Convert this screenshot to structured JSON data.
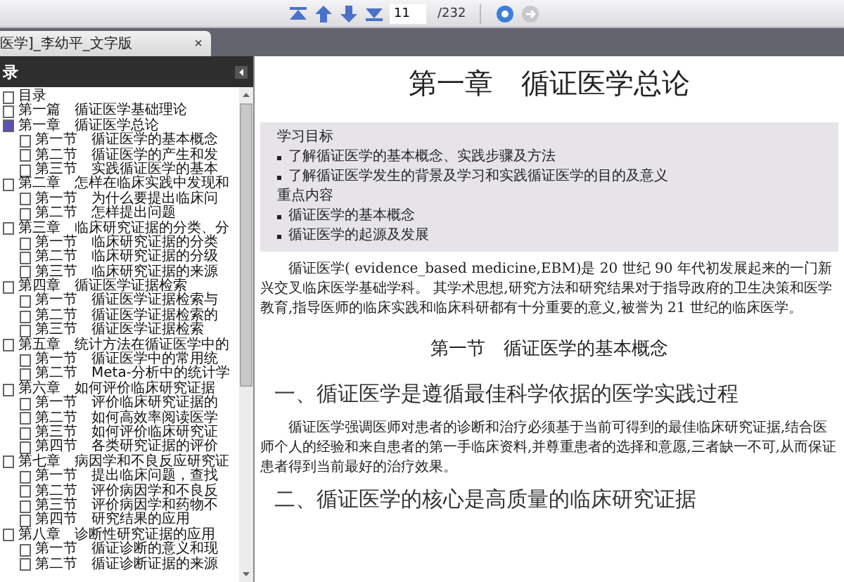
{
  "toolbar": {
    "page_field": {
      "value": "11"
    },
    "page_total": "/232",
    "buttons": [
      {
        "kind": "go",
        "disabled": false
      },
      {
        "kind": "forward",
        "disabled": true
      }
    ]
  },
  "tab": {
    "title": "医学]_李幼平_文字版",
    "close": "×"
  },
  "sidebar": {
    "title": "录",
    "items": [
      {
        "label": "目录",
        "selected": false
      },
      {
        "label": "第一篇　循证医学基础理论",
        "selected": false
      },
      {
        "label": "第一章　循证医学总论",
        "selected": true,
        "children": [
          {
            "label": "第一节　循证医学的基本概念",
            "selected": false
          },
          {
            "label": "第二节　循证医学的产生和发",
            "selected": false
          },
          {
            "label": "第三节　实践循证医学的基本",
            "selected": false
          }
        ]
      },
      {
        "label": "第二章　怎样在临床实践中发现和",
        "selected": false,
        "children": [
          {
            "label": "第一节　为什么要提出临床问",
            "selected": false
          },
          {
            "label": "第二节　怎样提出问题",
            "selected": false
          }
        ]
      },
      {
        "label": "第三章　临床研究证据的分类、分",
        "selected": false,
        "children": [
          {
            "label": "第一节　临床研究证据的分类",
            "selected": false
          },
          {
            "label": "第二节　临床研究证据的分级",
            "selected": false
          },
          {
            "label": "第三节　临床研究证据的来源",
            "selected": false
          }
        ]
      },
      {
        "label": "第四章　循证医学证据检索",
        "selected": false,
        "children": [
          {
            "label": "第一节　循证医学证据检索与",
            "selected": false
          },
          {
            "label": "第二节　循证医学证据检索的",
            "selected": false
          },
          {
            "label": "第三节　循证医学证据检索",
            "selected": false
          }
        ]
      },
      {
        "label": "第五章　统计方法在循证医学中的",
        "selected": false,
        "children": [
          {
            "label": "第一节　循证医学中的常用统",
            "selected": false
          },
          {
            "label": "第二节　Meta-分析中的统计学",
            "selected": false
          }
        ]
      },
      {
        "label": "第六章　如何评价临床研究证据",
        "selected": false,
        "children": [
          {
            "label": "第一节　评价临床研究证据的",
            "selected": false
          },
          {
            "label": "第二节　如何高效率阅读医学",
            "selected": false
          },
          {
            "label": "第三节　如何评价临床研究证",
            "selected": false
          },
          {
            "label": "第四节　各类研究证据的评价",
            "selected": false
          }
        ]
      },
      {
        "label": "第七章　病因学和不良反应研究证",
        "selected": false,
        "children": [
          {
            "label": "第一节　提出临床问题，查找",
            "selected": false
          },
          {
            "label": "第二节　评价病因学和不良反",
            "selected": false
          },
          {
            "label": "第三节　评价病因学和药物不",
            "selected": false
          },
          {
            "label": "第四节　研究结果的应用",
            "selected": false
          }
        ]
      },
      {
        "label": "第八章　诊断性研究证据的应用",
        "selected": false,
        "children": [
          {
            "label": "第一节　循证诊断的意义和现",
            "selected": false
          },
          {
            "label": "第二节　循证诊断证据的来源",
            "selected": false
          }
        ]
      }
    ]
  },
  "page": {
    "chapter_title": "第一章　循证医学总论",
    "objectives": {
      "heading": "学习目标",
      "items": [
        "了解循证医学的基本概念、实践步骤及方法",
        "了解循证医学发生的背景及学习和实践循证医学的目的及意义"
      ]
    },
    "key_points": {
      "heading": "重点内容",
      "items": [
        "循证医学的基本概念",
        "循证医学的起源及发展"
      ]
    },
    "intro": "循证医学( evidence_based medicine,EBM)是 20 世纪 90 年代初发展起来的一门新兴交叉临床医学基础学科。 其学术思想,研究方法和研究结果对于指导政府的卫生决策和医学教育,指导医师的临床实践和临床科研都有十分重要的意义,被誉为 21 世纪的临床医学。",
    "section_title": "第一节　循证医学的基本概念",
    "subsections": [
      {
        "heading": "一、循证医学是遵循最佳科学依据的医学实践过程",
        "body": "循证医学强调医师对患者的诊断和治疗必须基于当前可得到的最佳临床研究证据,结合医师个人的经验和来自患者的第一手临床资料,并尊重患者的选择和意愿,三者缺一不可,从而保证患者得到当前最好的治疗效果。"
      },
      {
        "heading": "二、循证医学的核心是高质量的临床研究证据"
      }
    ]
  }
}
